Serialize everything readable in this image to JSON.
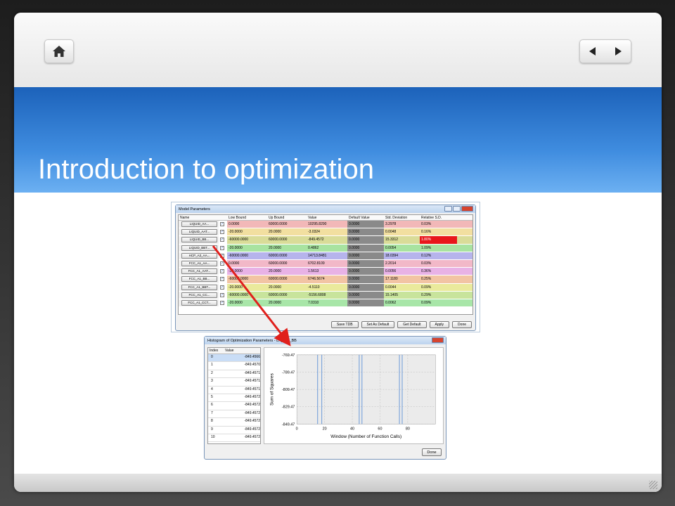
{
  "slide": {
    "title": "Introduction to optimization"
  },
  "nav": {
    "home_icon": "home-icon",
    "prev_icon": "prev-arrow-icon",
    "next_icon": "next-arrow-icon"
  },
  "model_window": {
    "title": "Model Parameters",
    "columns": [
      "Name",
      "",
      "Low Bound",
      "Up Bound",
      "Value",
      "Default Value",
      "Std. Deviation",
      "Relative S.D."
    ],
    "rows": [
      {
        "name": "LIQUID_AA...",
        "low": "0.0000",
        "up": "60000.0000",
        "value": "10295.8290",
        "def": "0.0000",
        "std": "3.2978",
        "rel": "0.03%",
        "color": "#f2b8b8"
      },
      {
        "name": "LIQUID_AAT...",
        "low": "-20.0000",
        "up": "20.0000",
        "value": "-3.0324",
        "def": "0.0000",
        "std": "0.0048",
        "rel": "0.16%",
        "color": "#f2dfa0"
      },
      {
        "name": "LIQUID_BB...",
        "low": "-60000.0000",
        "up": "60000.0000",
        "value": "-849.4572",
        "def": "0.0000",
        "std": "15.3312",
        "rel": "1.80%",
        "color": "#d9dc98"
      },
      {
        "name": "LIQUID_BBT...",
        "low": "-20.0000",
        "up": "20.0000",
        "value": "0.4862",
        "def": "0.0000",
        "std": "0.0054",
        "rel": "1.09%",
        "color": "#a8e3a0"
      },
      {
        "name": "HCP_A3_AA...",
        "low": "-60000.0000",
        "up": "60000.0000",
        "value": "14713.8481",
        "def": "0.0000",
        "std": "18.0394",
        "rel": "0.12%",
        "color": "#b6b4ec"
      },
      {
        "name": "FCC_A1_AA...",
        "low": "0.0000",
        "up": "60000.0000",
        "value": "6702.8109",
        "def": "0.0000",
        "std": "2.2014",
        "rel": "0.03%",
        "color": "#f2b8c8"
      },
      {
        "name": "FCC_A1_AAT...",
        "low": "-20.0000",
        "up": "20.0000",
        "value": "1.5613",
        "def": "0.0000",
        "std": "0.0056",
        "rel": "0.36%",
        "color": "#e8b2e6"
      },
      {
        "name": "FCC_A1_BB...",
        "low": "-60000.0000",
        "up": "60000.0000",
        "value": "6746.5674",
        "def": "0.0000",
        "std": "17.1180",
        "rel": "0.25%",
        "color": "#f2c4a4"
      },
      {
        "name": "FCC_A1_BBT...",
        "low": "-20.0000",
        "up": "20.0000",
        "value": "-4.5110",
        "def": "0.0000",
        "std": "0.0044",
        "rel": "0.09%",
        "color": "#eaea9c"
      },
      {
        "name": "FCC_A1_CC...",
        "low": "-60000.0000",
        "up": "60000.0000",
        "value": "-5156.6808",
        "def": "0.0000",
        "std": "15.1405",
        "rel": "0.29%",
        "color": "#c8e49c"
      },
      {
        "name": "FCC_A1_CCT...",
        "low": "-20.0000",
        "up": "20.0000",
        "value": "7.0310",
        "def": "0.0000",
        "std": "0.0062",
        "rel": "0.09%",
        "color": "#a8e6a8"
      }
    ],
    "buttons": [
      "Save TDB",
      "Set As Default",
      "Get Default",
      "Apply",
      "Done"
    ]
  },
  "hist_window": {
    "title": "Histogram of Optimization Parameters - LIQUID_BB",
    "columns": [
      "Index",
      "Value"
    ],
    "rows": [
      [
        "0",
        "-849.4566"
      ],
      [
        "1",
        "-849.4570"
      ],
      [
        "2",
        "-849.4571"
      ],
      [
        "3",
        "-849.4571"
      ],
      [
        "4",
        "-849.4571"
      ],
      [
        "5",
        "-849.4572"
      ],
      [
        "6",
        "-849.4572"
      ],
      [
        "7",
        "-849.4572"
      ],
      [
        "8",
        "-849.4572"
      ],
      [
        "9",
        "-849.4572"
      ],
      [
        "10",
        "-849.4572"
      ]
    ],
    "done": "Done"
  },
  "chart_data": {
    "type": "line",
    "xlabel": "Window (Number of Function Calls)",
    "ylabel": "Sum of Squares",
    "xlim": [
      0,
      100
    ],
    "ylim": [
      -849.47,
      -769.47
    ],
    "xticks": [
      0,
      20,
      40,
      60,
      80
    ],
    "yticks": [
      -769.47,
      -789.47,
      -809.47,
      -829.47,
      -849.47
    ],
    "ytick_labels": [
      "-769.47",
      "-789.47",
      "-809.47",
      "-829.47",
      "-849.47"
    ],
    "spikes_x": [
      15,
      18,
      45,
      47,
      74,
      76
    ],
    "spike_top": -769.47,
    "baseline": -849.47,
    "line_color": "#5b8fd6",
    "grid": true
  }
}
